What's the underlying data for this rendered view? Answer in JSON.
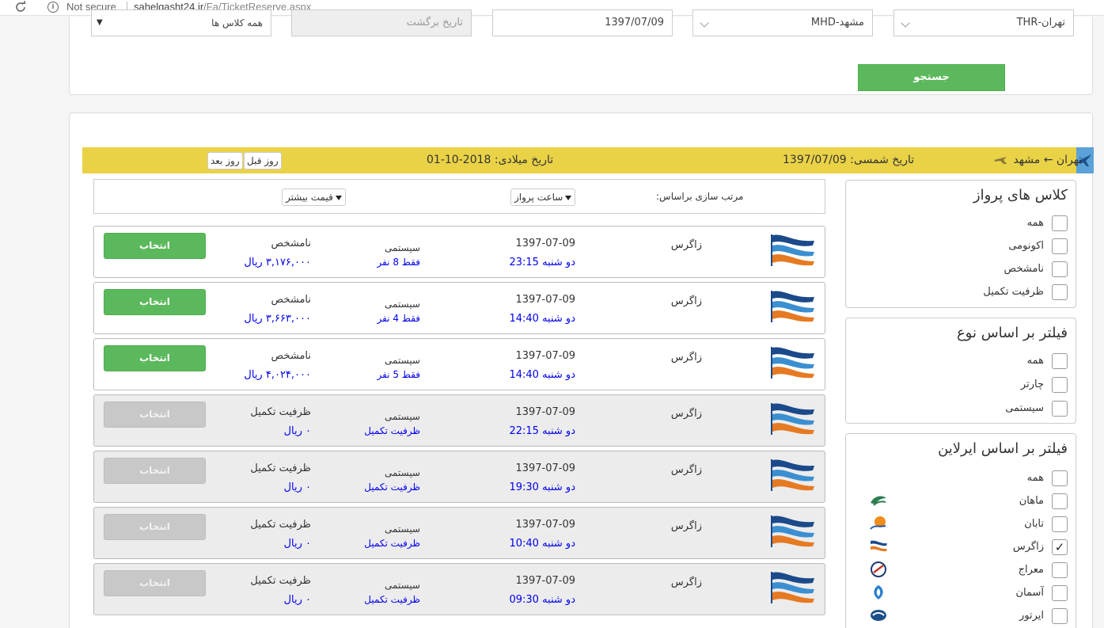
{
  "browser": {
    "security_label": "Not secure",
    "url_host": "sahelgasht24.ir",
    "url_path": "/Fa/TicketReserve.aspx"
  },
  "search": {
    "origin": "تهران-THR",
    "destination": "مشهد-MHD",
    "depart_date": "1397/07/09",
    "return_placeholder": "تاریخ برگشت",
    "class_value": "همه کلاس ها",
    "search_label": "جستجو"
  },
  "bar": {
    "route": "تهران ← مشهد",
    "shamsi": "تاریخ شمسی: 1397/07/09",
    "miladi": "تاریخ میلادی: 2018-10-01",
    "prev_day": "روز قبل",
    "next_day": "روز بعد"
  },
  "sort": {
    "label": "مرتب سازی براساس:",
    "by_time": "ساعت پرواز",
    "by_price": "قیمت بیشتر"
  },
  "flights": [
    {
      "airline": "زاگرس",
      "date": "1397-07-09",
      "time": "دو شنبه 23:15",
      "type": "سیستمی",
      "seats": "فقط 8 نفر",
      "cls": "نامشخص",
      "price": "۳,۱۷۶,۰۰۰ ریال",
      "select": "انتخاب",
      "full": false
    },
    {
      "airline": "زاگرس",
      "date": "1397-07-09",
      "time": "دو شنبه 14:40",
      "type": "سیستمی",
      "seats": "فقط 4 نفر",
      "cls": "نامشخص",
      "price": "۳,۶۶۳,۰۰۰ ریال",
      "select": "انتخاب",
      "full": false
    },
    {
      "airline": "زاگرس",
      "date": "1397-07-09",
      "time": "دو شنبه 14:40",
      "type": "سیستمی",
      "seats": "فقط 5 نفر",
      "cls": "نامشخص",
      "price": "۴,۰۲۴,۰۰۰ ریال",
      "select": "انتخاب",
      "full": false
    },
    {
      "airline": "زاگرس",
      "date": "1397-07-09",
      "time": "دو شنبه 22:15",
      "type": "سیستمی",
      "seats": "ظرفیت تکمیل",
      "cls": "ظرفیت تکمیل",
      "price": "۰ ریال",
      "select": "انتخاب",
      "full": true
    },
    {
      "airline": "زاگرس",
      "date": "1397-07-09",
      "time": "دو شنبه 19:30",
      "type": "سیستمی",
      "seats": "ظرفیت تکمیل",
      "cls": "ظرفیت تکمیل",
      "price": "۰ ریال",
      "select": "انتخاب",
      "full": true
    },
    {
      "airline": "زاگرس",
      "date": "1397-07-09",
      "time": "دو شنبه 10:40",
      "type": "سیستمی",
      "seats": "ظرفیت تکمیل",
      "cls": "ظرفیت تکمیل",
      "price": "۰ ریال",
      "select": "انتخاب",
      "full": true
    },
    {
      "airline": "زاگرس",
      "date": "1397-07-09",
      "time": "دو شنبه 09:30",
      "type": "سیستمی",
      "seats": "ظرفیت تکمیل",
      "cls": "ظرفیت تکمیل",
      "price": "۰ ریال",
      "select": "انتخاب",
      "full": true
    }
  ],
  "filters": {
    "classes": {
      "title": "کلاس های پرواز",
      "items": [
        "همه",
        "اکونومی",
        "نامشخص",
        "ظرفیت تکمیل"
      ]
    },
    "types": {
      "title": "فیلتر بر اساس نوع",
      "items": [
        "همه",
        "چارتر",
        "سیستمی"
      ]
    },
    "airlines": {
      "title": "فیلتر بر اساس ایرلاین",
      "items": [
        {
          "label": "همه",
          "checked": false,
          "logo": ""
        },
        {
          "label": "ماهان",
          "checked": false,
          "logo": "mahan-logo-icon"
        },
        {
          "label": "تابان",
          "checked": false,
          "logo": "taban-logo-icon"
        },
        {
          "label": "زاگرس",
          "checked": true,
          "logo": "zagros-logo-icon"
        },
        {
          "label": "معراج",
          "checked": false,
          "logo": "meraj-logo-icon"
        },
        {
          "label": "آسمان",
          "checked": false,
          "logo": "aseman-logo-icon"
        },
        {
          "label": "ایرتور",
          "checked": false,
          "logo": "airtour-logo-icon"
        }
      ]
    }
  },
  "colors": {
    "accent_green": "#5cb85c",
    "bar_yellow": "#ead247",
    "link_blue": "#0000ee",
    "disabled_gray": "#c8c8c8"
  }
}
